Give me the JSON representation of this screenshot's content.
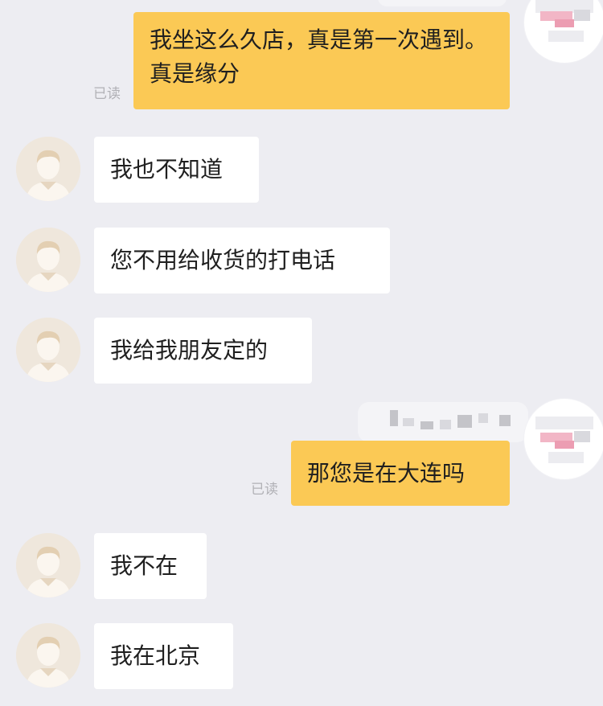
{
  "chat": {
    "messages": [
      {
        "side": "out",
        "text": "我坐这么久店，真是第一次遇到。真是缘分",
        "read": "已读"
      },
      {
        "side": "in",
        "text": "我也不知道"
      },
      {
        "side": "in",
        "text": "您不用给收货的打电话"
      },
      {
        "side": "in",
        "text": "我给我朋友定的"
      },
      {
        "side": "out",
        "text": "那您是在大连吗",
        "read": "已读"
      },
      {
        "side": "in",
        "text": "我不在"
      },
      {
        "side": "in",
        "text": "我在北京"
      }
    ]
  },
  "icons": {
    "contact_avatar": "default-person-avatar-icon",
    "my_avatar": "pixelated-avatar"
  },
  "colors": {
    "background": "#ededf2",
    "outgoing_bubble": "#fbc955",
    "incoming_bubble": "#ffffff",
    "read_receipt": "#b1b1b6",
    "avatar_bg": "#efe7dc"
  }
}
